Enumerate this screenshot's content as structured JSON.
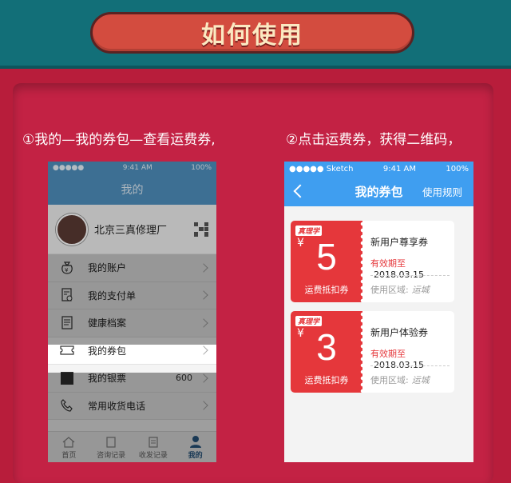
{
  "header": {
    "title": "如何使用"
  },
  "steps": {
    "step1": "①我的—我的券包—查看运费券,",
    "step2": "②点击运费券，获得二维码，"
  },
  "phone1": {
    "status": {
      "carrier": "●●●●● ",
      "time": "9:41 AM",
      "battery": "100%"
    },
    "nav_title": "我的",
    "profile_name": "北京三真修理厂",
    "menu": [
      {
        "label": "我的账户",
        "icon": "money-bag-icon"
      },
      {
        "label": "我的支付单",
        "icon": "payment-list-icon"
      },
      {
        "label": "健康档案",
        "icon": "document-icon"
      },
      {
        "label": "我的券包",
        "icon": "ticket-icon",
        "active": true
      },
      {
        "label": "我的银票",
        "icon": "card-icon",
        "value": "600"
      },
      {
        "label": "常用收货电话",
        "icon": "phone-icon"
      }
    ],
    "tabs": [
      {
        "label": "首页",
        "icon": "home-icon"
      },
      {
        "label": "咨询记录",
        "icon": "record-icon"
      },
      {
        "label": "收发记录",
        "icon": "send-record-icon"
      },
      {
        "label": "我的",
        "icon": "user-icon",
        "active": true
      }
    ]
  },
  "phone2": {
    "status": {
      "carrier": "●●●●● Sketch",
      "time": "9:41 AM",
      "battery": "100%"
    },
    "nav_title": "我的券包",
    "nav_right": "使用规则",
    "coupons": [
      {
        "logo": "真理学",
        "currency": "¥",
        "amount": "5",
        "type": "运费抵扣券",
        "name": "新用户尊享券",
        "expiry_label": "有效期至",
        "expiry": "2018.03.15",
        "zone_label": "使用区域:",
        "zone": "运城"
      },
      {
        "logo": "真理学",
        "currency": "¥",
        "amount": "3",
        "type": "运费抵扣券",
        "name": "新用户体验券",
        "expiry_label": "有效期至",
        "expiry": "2018.03.15",
        "zone_label": "使用区域:",
        "zone": "运城"
      }
    ]
  },
  "colors": {
    "bg": "#b81d3b",
    "band": "#126f78",
    "pill": "#d34c3f",
    "coupon_red": "#e5373b",
    "blue": "#3f9ef0"
  }
}
